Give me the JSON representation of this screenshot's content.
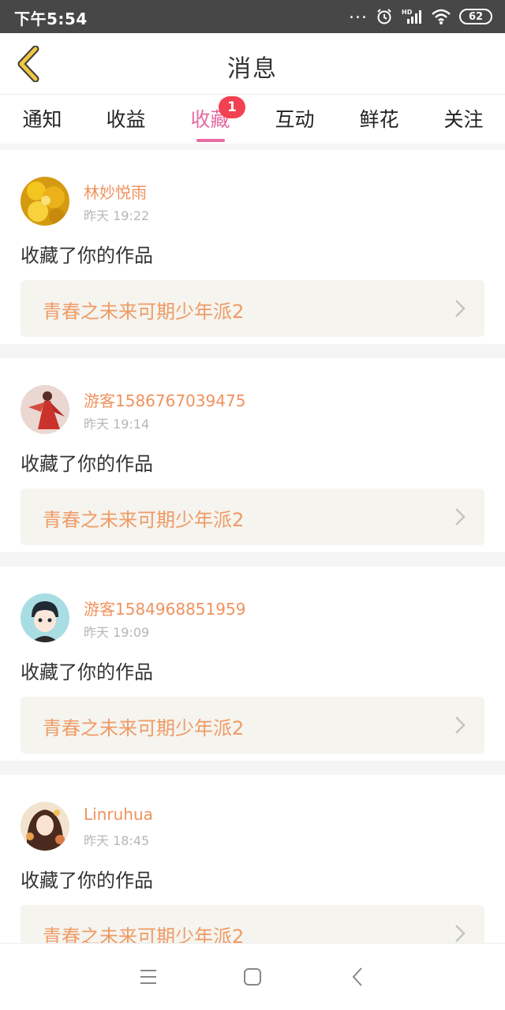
{
  "status_bar": {
    "time": "下午5:54",
    "dots": "...",
    "battery": "62",
    "icons": [
      "alarm-icon",
      "hd-signal-icon",
      "wifi-icon",
      "battery-icon"
    ]
  },
  "header": {
    "title": "消息",
    "back_icon": "chevron-left-icon",
    "accent_color": "#f0c642"
  },
  "tabs": [
    {
      "label": "通知",
      "active": false
    },
    {
      "label": "收益",
      "active": false
    },
    {
      "label": "收藏",
      "active": true,
      "badge": "1"
    },
    {
      "label": "互动",
      "active": false
    },
    {
      "label": "鲜花",
      "active": false
    },
    {
      "label": "关注",
      "active": false
    }
  ],
  "colors": {
    "active_tab": "#e66aa3",
    "badge": "#f24150",
    "username": "#f0925e",
    "work_title": "#ef9b66"
  },
  "feed": [
    {
      "username": "林妙悦雨",
      "time": "昨天 19:22",
      "action": "收藏了你的作品",
      "work_title": "青春之未来可期少年派2",
      "avatar": "yellow-flowers-avatar"
    },
    {
      "username": "游客1586767039475",
      "time": "昨天 19:14",
      "action": "收藏了你的作品",
      "work_title": "青春之未来可期少年派2",
      "avatar": "red-dress-figure-avatar"
    },
    {
      "username": "游客1584968851959",
      "time": "昨天 19:09",
      "action": "收藏了你的作品",
      "work_title": "青春之未来可期少年派2",
      "avatar": "cartoon-boy-avatar"
    },
    {
      "username": "Linruhua",
      "time": "昨天 18:45",
      "action": "收藏了你的作品",
      "work_title": "青春之未来可期少年派2",
      "avatar": "anime-girl-avatar"
    }
  ],
  "nav_bar": {
    "buttons": [
      "menu-icon",
      "home-square-icon",
      "back-triangle-icon"
    ]
  }
}
